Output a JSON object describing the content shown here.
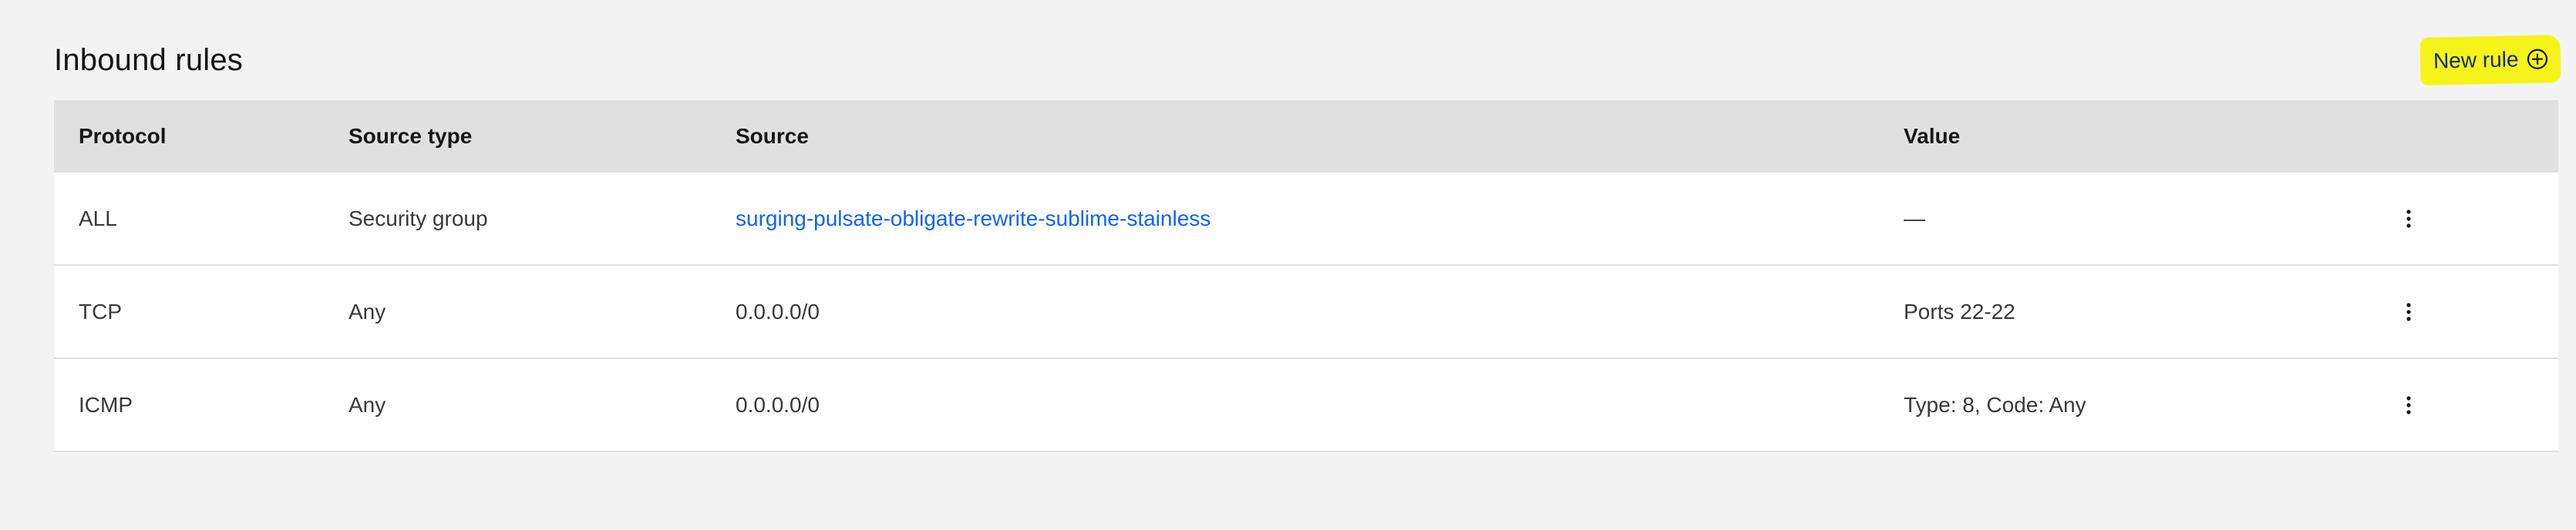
{
  "section": {
    "title": "Inbound rules",
    "new_rule_label": "New rule",
    "new_rule_icon": "add-circle-icon",
    "highlight_color": "#f4f41a"
  },
  "table": {
    "columns": [
      "Protocol",
      "Source type",
      "Source",
      "Value"
    ],
    "rows": [
      {
        "protocol": "ALL",
        "source_type": "Security group",
        "source": "surging-pulsate-obligate-rewrite-sublime-stainless",
        "source_is_link": true,
        "value": "—"
      },
      {
        "protocol": "TCP",
        "source_type": "Any",
        "source": "0.0.0.0/0",
        "source_is_link": false,
        "value": "Ports 22-22"
      },
      {
        "protocol": "ICMP",
        "source_type": "Any",
        "source": "0.0.0.0/0",
        "source_is_link": false,
        "value": "Type: 8, Code: Any"
      }
    ],
    "row_menu_icon": "overflow-menu-vertical-icon"
  },
  "colors": {
    "link": "#0f62fe",
    "header_bg": "#e0e0e0",
    "page_bg": "#f3f3f3"
  }
}
